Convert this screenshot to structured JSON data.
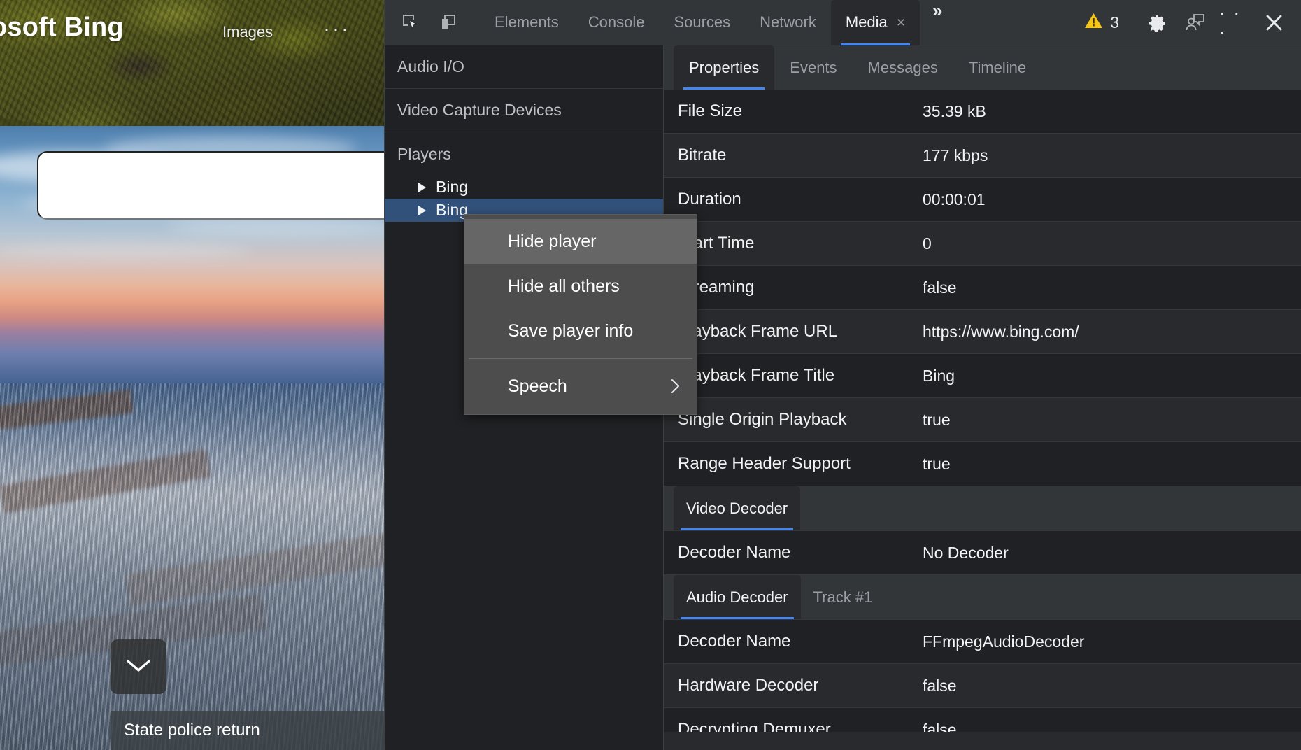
{
  "page": {
    "brand": "rosoft Bing",
    "nav_images": "Images",
    "nav_more": "···",
    "search_value": "",
    "search_placeholder": "",
    "scroll_icon": "chevron-down-icon",
    "headline": "State police return"
  },
  "devtools": {
    "toolbar": {
      "inspect_icon": "inspect-element-icon",
      "device_icon": "device-toolbar-icon",
      "tabs": [
        {
          "label": "Elements",
          "active": false,
          "closable": false
        },
        {
          "label": "Console",
          "active": false,
          "closable": false
        },
        {
          "label": "Sources",
          "active": false,
          "closable": false
        },
        {
          "label": "Network",
          "active": false,
          "closable": false
        },
        {
          "label": "Media",
          "active": true,
          "closable": true
        }
      ],
      "close_tab_glyph": "×",
      "more_tabs_glyph": "»",
      "warning_icon": "warning-triangle-icon",
      "warning_count": "3",
      "settings_icon": "gear-icon",
      "feedback_icon": "feedback-person-icon",
      "more_options_glyph": "· · ·",
      "close_icon": "close-icon",
      "accent_color": "#4285f4",
      "warning_color": "#f5c518"
    },
    "sidebar": {
      "sections": [
        {
          "label": "Audio I/O"
        },
        {
          "label": "Video Capture Devices"
        }
      ],
      "players_label": "Players",
      "players": [
        {
          "label": "Bing",
          "selected": false
        },
        {
          "label": "Bing",
          "selected": true
        }
      ],
      "selection_color": "#32517a"
    },
    "main": {
      "tabs": [
        {
          "label": "Properties",
          "active": true
        },
        {
          "label": "Events",
          "active": false
        },
        {
          "label": "Messages",
          "active": false
        },
        {
          "label": "Timeline",
          "active": false
        }
      ],
      "properties": [
        {
          "key": "File Size",
          "value": "35.39 kB"
        },
        {
          "key": "Bitrate",
          "value": "177 kbps"
        },
        {
          "key": "Duration",
          "value": "00:00:01"
        },
        {
          "key": "Start Time",
          "value": "0"
        },
        {
          "key": "Streaming",
          "value": "false"
        },
        {
          "key": "Playback Frame URL",
          "value": "https://www.bing.com/"
        },
        {
          "key": "Playback Frame Title",
          "value": "Bing"
        },
        {
          "key": "Single Origin Playback",
          "value": "true"
        },
        {
          "key": "Range Header Support",
          "value": "true"
        }
      ],
      "video_decoder": {
        "tabs": [
          {
            "label": "Video Decoder",
            "active": true
          }
        ],
        "properties": [
          {
            "key": "Decoder Name",
            "value": "No Decoder"
          }
        ]
      },
      "audio_decoder": {
        "tabs": [
          {
            "label": "Audio Decoder",
            "active": true
          },
          {
            "label": "Track #1",
            "active": false
          }
        ],
        "properties": [
          {
            "key": "Decoder Name",
            "value": "FFmpegAudioDecoder"
          },
          {
            "key": "Hardware Decoder",
            "value": "false"
          },
          {
            "key": "Decrypting Demuxer",
            "value": "false"
          }
        ]
      }
    },
    "context_menu": {
      "items": [
        {
          "label": "Hide player",
          "highlighted": true,
          "submenu": false
        },
        {
          "label": "Hide all others",
          "highlighted": false,
          "submenu": false
        },
        {
          "label": "Save player info",
          "highlighted": false,
          "submenu": false
        },
        {
          "label": "Speech",
          "highlighted": false,
          "submenu": true,
          "separator_before": true
        }
      ]
    }
  }
}
